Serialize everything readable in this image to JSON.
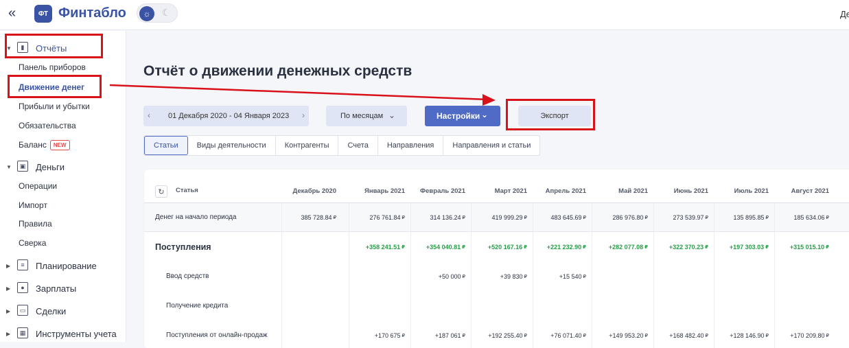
{
  "header": {
    "collapse_icon": "«",
    "logo_text": "ФТ",
    "brand": "Финтабло",
    "right_text": "Де"
  },
  "sidebar": {
    "reports": "Отчёты",
    "reports_items": [
      "Панель приборов",
      "Движение денег",
      "Прибыли и убытки",
      "Обязательства",
      "Баланс"
    ],
    "new_badge": "NEW",
    "money": "Деньги",
    "money_items": [
      "Операции",
      "Импорт",
      "Правила",
      "Сверка"
    ],
    "planning": "Планирование",
    "salaries": "Зарплаты",
    "deals": "Сделки",
    "tools": "Инструменты учета"
  },
  "main": {
    "title": "Отчёт о движении денежных средств",
    "date_range": "01 Декабря 2020 - 04 Января 2023",
    "period": "По месяцам",
    "settings": "Настройки",
    "export": "Экспорт",
    "tabs": [
      "Статьи",
      "Виды деятельности",
      "Контрагенты",
      "Счета",
      "Направления",
      "Направления и статьи"
    ]
  },
  "table": {
    "article_header": "Статья",
    "columns": [
      "Декабрь 2020",
      "Январь 2021",
      "Февраль 2021",
      "Март 2021",
      "Апрель 2021",
      "Май 2021",
      "Июнь 2021",
      "Июль 2021",
      "Август 2021"
    ],
    "currency": "₽",
    "rows": [
      {
        "name": "Денег на начало периода",
        "values": [
          "385 728.84",
          "276 761.84",
          "314 136.24",
          "419 999.29",
          "483 645.69",
          "286 976.80",
          "273 539.97",
          "135 895.85",
          "185 634.06"
        ]
      },
      {
        "name": "Поступления",
        "values": [
          "",
          "+358 241.51",
          "+354 040.81",
          "+520 167.16",
          "+221 232.90",
          "+282 077.08",
          "+322 370.23",
          "+197 303.03",
          "+315 015.10"
        ]
      },
      {
        "name": "Ввод средств",
        "values": [
          "",
          "",
          "+50 000",
          "+39 830",
          "+15 540",
          "",
          "",
          "",
          ""
        ]
      },
      {
        "name": "Получение кредита",
        "values": [
          "",
          "",
          "",
          "",
          "",
          "",
          "",
          "",
          ""
        ]
      },
      {
        "name": "Поступления от онлайн-продаж",
        "values": [
          "",
          "+170 675",
          "+187 061",
          "+192 255.40",
          "+76 071.40",
          "+149 953.20",
          "+168 482.40",
          "+128 146.90",
          "+170 209.80"
        ]
      }
    ]
  },
  "colors": {
    "accent": "#3a53a4",
    "button_primary": "#4f6bc5",
    "positive": "#23a045",
    "highlight": "#d8111b"
  }
}
